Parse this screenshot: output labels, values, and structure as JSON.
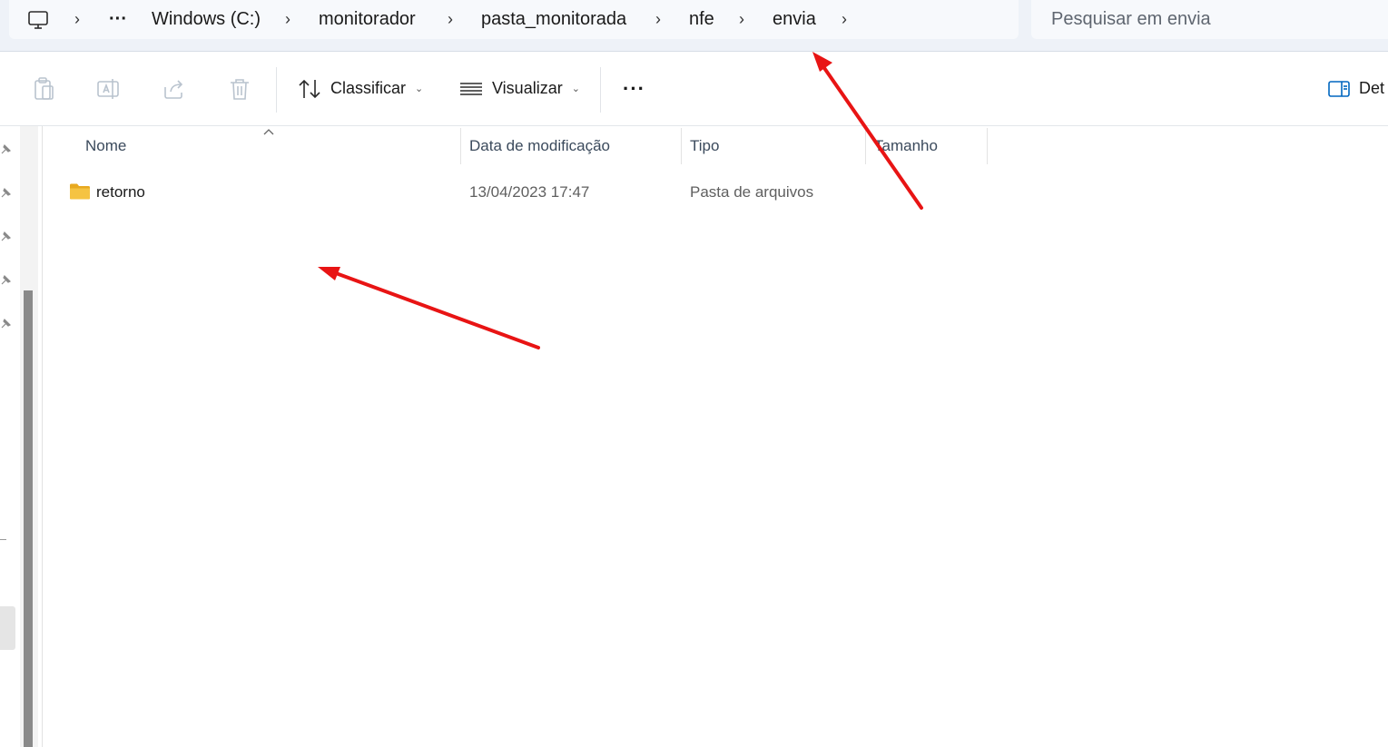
{
  "address_bar": {
    "overflow_label": "···",
    "crumbs": [
      "Windows (C:)",
      "monitorador",
      "pasta_monitorada",
      "nfe",
      "envia"
    ],
    "separator": "›"
  },
  "search": {
    "placeholder": "Pesquisar em envia"
  },
  "toolbar": {
    "sort_label": "Classificar",
    "view_label": "Visualizar",
    "more_label": "···",
    "details_label": "Det"
  },
  "columns": [
    "Nome",
    "Data de modificação",
    "Tipo",
    "Tamanho"
  ],
  "files": [
    {
      "name": "retorno",
      "modified": "13/04/2023 17:47",
      "type": "Pasta de arquivos",
      "size": ""
    }
  ],
  "colors": {
    "folder": "#f5c342",
    "arrow": "#e81414",
    "accent": "#0067c0"
  }
}
